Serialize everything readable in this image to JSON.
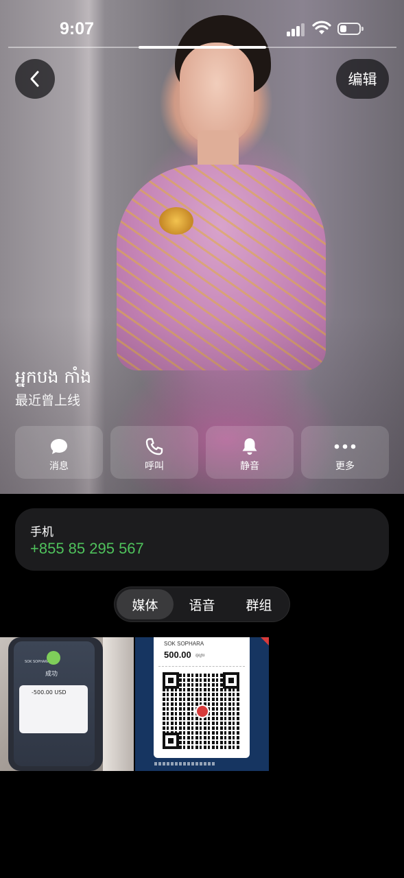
{
  "status_bar": {
    "time": "9:07",
    "signal_bars": 3,
    "battery_level": 0.35
  },
  "header": {
    "back_icon": "chevron-left-icon",
    "edit_label": "编辑"
  },
  "contact": {
    "name": "អ្នកបង កាំង",
    "status": "最近曾上线"
  },
  "actions": [
    {
      "label": "消息",
      "icon": "message-bubble-icon"
    },
    {
      "label": "呼叫",
      "icon": "phone-icon"
    },
    {
      "label": "静音",
      "icon": "bell-icon"
    },
    {
      "label": "更多",
      "icon": "more-dots-icon"
    }
  ],
  "phone": {
    "label": "手机",
    "number": "+855 85 295 567",
    "number_color": "#4fc25c"
  },
  "tabs": [
    {
      "label": "媒体",
      "selected": true
    },
    {
      "label": "语音",
      "selected": false
    },
    {
      "label": "群组",
      "selected": false
    }
  ],
  "media": [
    {
      "kind": "photo",
      "status_text": "成功",
      "amount": "-500.00 USD",
      "account": "SOK SOPHARA"
    },
    {
      "kind": "qr-receipt",
      "name": "SOK SOPHARA",
      "amount": "500.00",
      "unit": "ដុល្លារ"
    }
  ]
}
